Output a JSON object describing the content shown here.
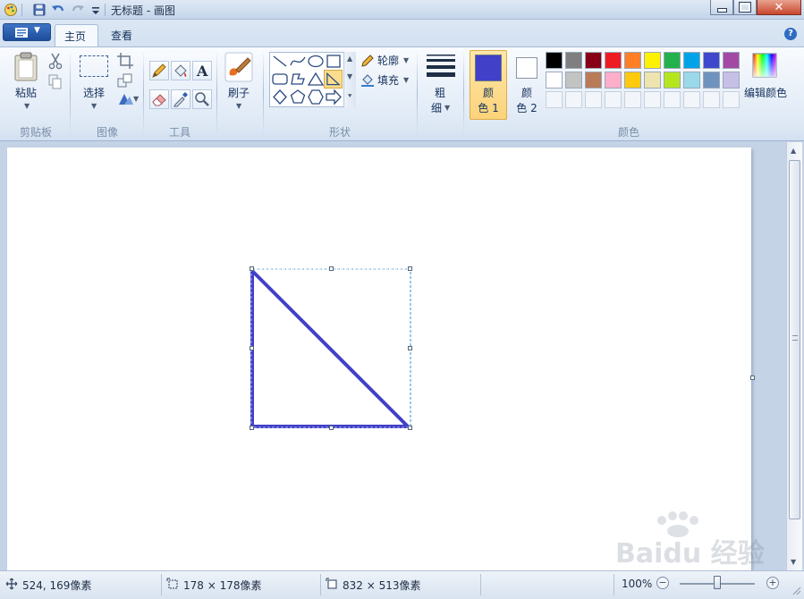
{
  "window": {
    "title": "无标题 - 画图",
    "controls": [
      "minimize",
      "maximize",
      "close"
    ]
  },
  "quick_access": [
    "paint-app-icon",
    "save-icon",
    "undo-icon",
    "redo-icon",
    "customize-dropdown-icon"
  ],
  "tabs": [
    {
      "label": "主页",
      "active": true
    },
    {
      "label": "查看",
      "active": false
    }
  ],
  "groups": {
    "clipboard": {
      "label": "剪贴板",
      "paste_label": "粘贴"
    },
    "image": {
      "label": "图像",
      "select_label": "选择"
    },
    "tools": {
      "label": "工具"
    },
    "brushes": {
      "label_line1": "刷子"
    },
    "shapes": {
      "label": "形状",
      "outline_label": "轮廓",
      "fill_label": "填充"
    },
    "size": {
      "label_line1": "粗",
      "label_line2": "细"
    },
    "colors": {
      "label": "颜色",
      "color1_line1": "颜",
      "color1_line2": "色 1",
      "color2_line1": "颜",
      "color2_line2": "色 2",
      "color1_value": "#4040c8",
      "color2_value": "#ffffff",
      "edit_label": "编辑颜色",
      "palette_row1": [
        "#000000",
        "#7f7f7f",
        "#880015",
        "#ed1c24",
        "#ff7f27",
        "#fff200",
        "#22b14c",
        "#00a2e8",
        "#3f48cc",
        "#a349a4"
      ],
      "palette_row2": [
        "#ffffff",
        "#c3c3c3",
        "#b97a57",
        "#ffaec9",
        "#ffc90e",
        "#efe4b0",
        "#b5e61d",
        "#99d9ea",
        "#7092be",
        "#c8bfe7"
      ]
    }
  },
  "status": {
    "cursor_pos": "524, 169像素",
    "selection_size": "178 × 178像素",
    "canvas_size": "832 × 513像素",
    "zoom": "100%"
  },
  "drawing": {
    "shape": "right-triangle",
    "stroke_color": "#4040c8",
    "selected": true
  },
  "watermark": "Baidu 经验"
}
